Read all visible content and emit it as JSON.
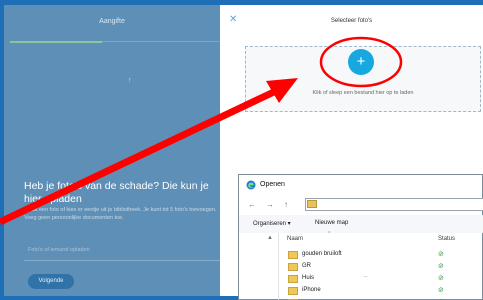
{
  "left_page": {
    "tab_label": "Aangifte",
    "upload_glyph": "↑",
    "heading": "Heb je foto's van de schade? Die kun je hier opladen",
    "helper_text": "Maak een foto of kies er eentje uit je bibliotheek. Je kunt tot 5 foto's toevoegen. Voeg geen persoonlijke documenten toe.",
    "input_placeholder": "Foto's of iemand opladen",
    "next_button": "Volgende"
  },
  "photo_dialog": {
    "title": "Selecteer foto's",
    "close_glyph": "✕",
    "add_glyph": "+",
    "dropzone_hint": "Klik of sleep een bestand hier op te laden",
    "accent_color": "#18a8e0"
  },
  "annotation": {
    "color": "#ff0000"
  },
  "file_dialog": {
    "title": "Openen",
    "nav": {
      "back": "←",
      "forward": "→",
      "up": "↑"
    },
    "toolbar": {
      "organize": "Organiseren ▾",
      "new_folder": "Nieuwe map"
    },
    "columns": {
      "name": "Naam",
      "status": "Status"
    },
    "rows": [
      {
        "name": "gouden bruiloft",
        "extra": "",
        "status": "⊘"
      },
      {
        "name": "GR",
        "extra": "",
        "status": "⊘"
      },
      {
        "name": "Huis",
        "extra": "–",
        "status": "⊘"
      },
      {
        "name": "iPhone",
        "extra": "",
        "status": "⊘"
      },
      {
        "name": "",
        "extra": "",
        "status": "⊘"
      }
    ]
  }
}
